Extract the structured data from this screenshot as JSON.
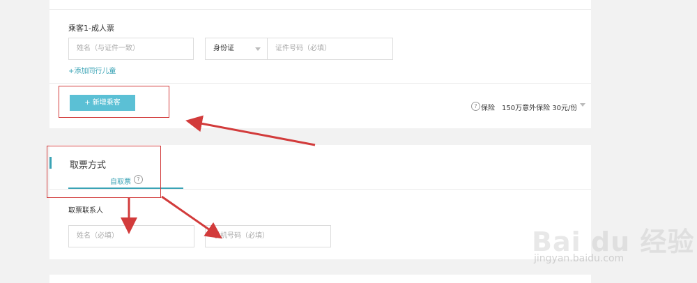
{
  "passenger": {
    "header": "乘客1-成人票",
    "name_placeholder": "姓名（与证件一致）",
    "id_type": "身份证",
    "id_placeholder": "证件号码（必填）",
    "add_child_link": "+添加同行儿童",
    "add_passenger_button": "+ 新增乘客",
    "insurance_help_icon": "?",
    "insurance_label": "保险",
    "insurance_value": "150万意外保险 30元/份"
  },
  "ticket_method": {
    "title": "取票方式",
    "tab_label": "自取票",
    "tab_help_icon": "?",
    "contact_label": "取票联系人",
    "contact_name_placeholder": "姓名（必填）",
    "contact_phone_placeholder": "手机号码（必填）"
  },
  "watermark": {
    "logo_text": "Bai du 经验",
    "site": "jingyan.baidu.com"
  },
  "colors": {
    "accent": "#3aa3b5",
    "button": "#5bc0d5",
    "annotation": "#d23b3b"
  },
  "icons": [
    "help-circle-icon",
    "caret-down-icon",
    "annotation-arrow"
  ]
}
